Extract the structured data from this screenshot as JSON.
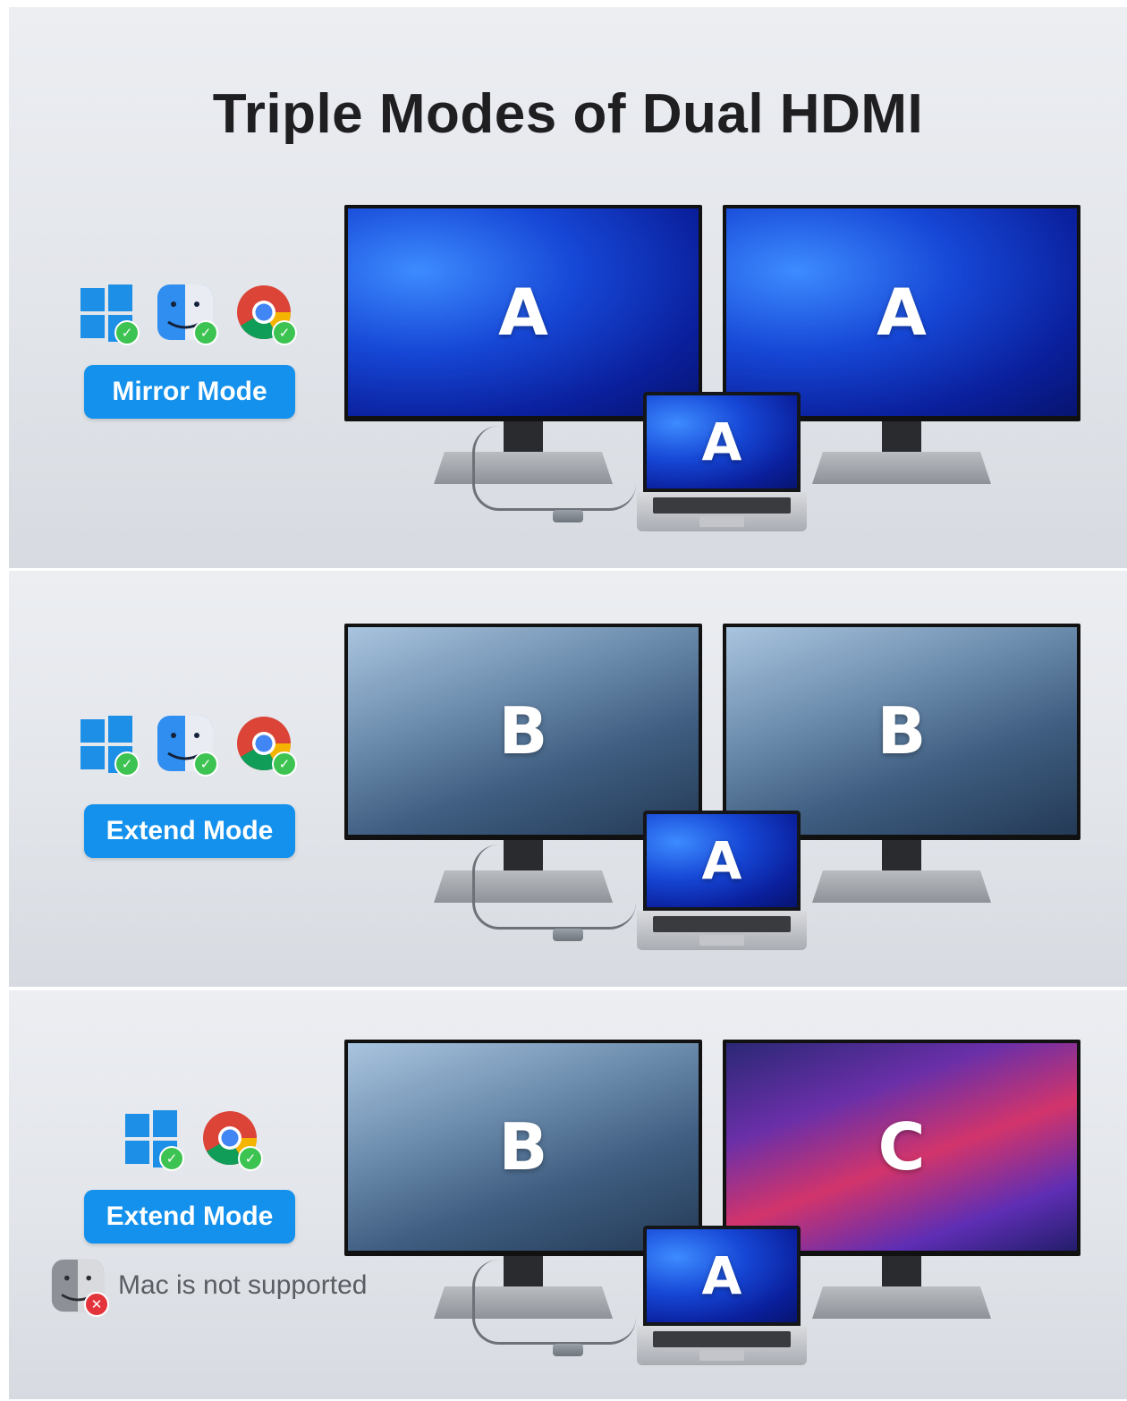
{
  "title": "Triple Modes of Dual HDMI",
  "sections": [
    {
      "mode_label": "Mirror Mode",
      "os": [
        "windows",
        "macos",
        "chrome-os"
      ],
      "screens": {
        "left": "A",
        "right": "A",
        "laptop": "A"
      }
    },
    {
      "mode_label": "Extend Mode",
      "os": [
        "windows",
        "macos",
        "chrome-os"
      ],
      "screens": {
        "left": "B",
        "right": "B",
        "laptop": "A"
      }
    },
    {
      "mode_label": "Extend Mode",
      "os": [
        "windows",
        "chrome-os"
      ],
      "screens": {
        "left": "B",
        "right": "C",
        "laptop": "A"
      },
      "note": "Mac is not supported"
    }
  ],
  "colors": {
    "accent": "#1391ec",
    "check": "#3dc351",
    "cross": "#e4343b"
  }
}
